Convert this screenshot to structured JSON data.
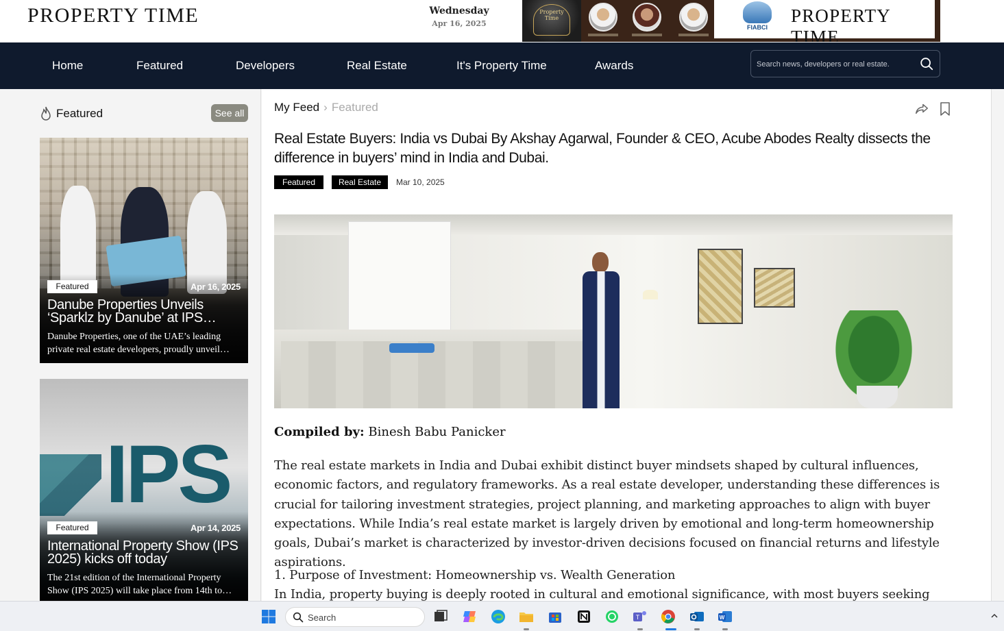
{
  "header": {
    "logo": "PROPERTY TIME",
    "day": "Wednesday",
    "date": "Apr 16, 2025",
    "banner": {
      "award_text": "Property Time",
      "brand_text": "PROPERTY TIME",
      "fiabci_text": "FIABCI"
    }
  },
  "nav": {
    "items": [
      "Home",
      "Featured",
      "Developers",
      "Real Estate",
      "It's Property Time",
      "Awards"
    ],
    "search_placeholder": "Search news, developers or real estate."
  },
  "sidebar": {
    "title": "Featured",
    "see_all": "See all",
    "cards": [
      {
        "tag": "Featured",
        "date": "Apr 16, 2025",
        "title": "Danube Properties Unveils ‘Sparklz by Danube’ at IPS…",
        "desc": "Danube Properties, one of the UAE’s leading private real estate developers, proudly unveil…"
      },
      {
        "tag": "Featured",
        "date": "Apr 14, 2025",
        "title": "International Property Show (IPS 2025) kicks off today",
        "desc": "The 21st edition of the International Property Show (IPS 2025) will take place from 14th to…",
        "image_text": "IPS"
      }
    ]
  },
  "article": {
    "breadcrumb": [
      "My Feed",
      "Featured"
    ],
    "headline": "Real Estate Buyers: India vs Dubai By Akshay Agarwal, Founder & CEO, Acube Abodes Realty dissects the difference in buyers’ mind in India and Dubai.",
    "tags": [
      "Featured",
      "Real Estate"
    ],
    "date": "Mar 10, 2025",
    "byline_label": "Compiled by:",
    "byline_name": "Binesh Babu Panicker",
    "paragraphs": [
      "The real estate markets in India and Dubai exhibit distinct buyer mindsets shaped by cultural influences, economic factors, and regulatory frameworks. As a real estate developer, understanding these differences is crucial for tailoring investment strategies, project planning, and marketing approaches to align with buyer expectations. While India’s real estate market is largely driven by emotional and long-term homeownership goals, Dubai’s market is characterized by investor-driven decisions focused on financial returns and lifestyle aspirations.",
      "1. Purpose of Investment: Homeownership vs. Wealth Generation",
      "In India, property buying is deeply rooted in cultural and emotional significance, with most buyers seeking homes for"
    ],
    "icons": [
      "share-icon",
      "bookmark-icon"
    ]
  },
  "taskbar": {
    "search_label": "Search",
    "apps": [
      "windows-start-icon",
      "task-view-icon",
      "copilot-icon",
      "edge-icon",
      "file-explorer-icon",
      "ms-store-icon",
      "notion-icon",
      "whatsapp-icon",
      "teams-icon",
      "chrome-icon",
      "outlook-icon",
      "word-icon"
    ],
    "colors": {
      "navbar": "#0f1a2d",
      "accent_see_all": "#8a8a80"
    }
  }
}
